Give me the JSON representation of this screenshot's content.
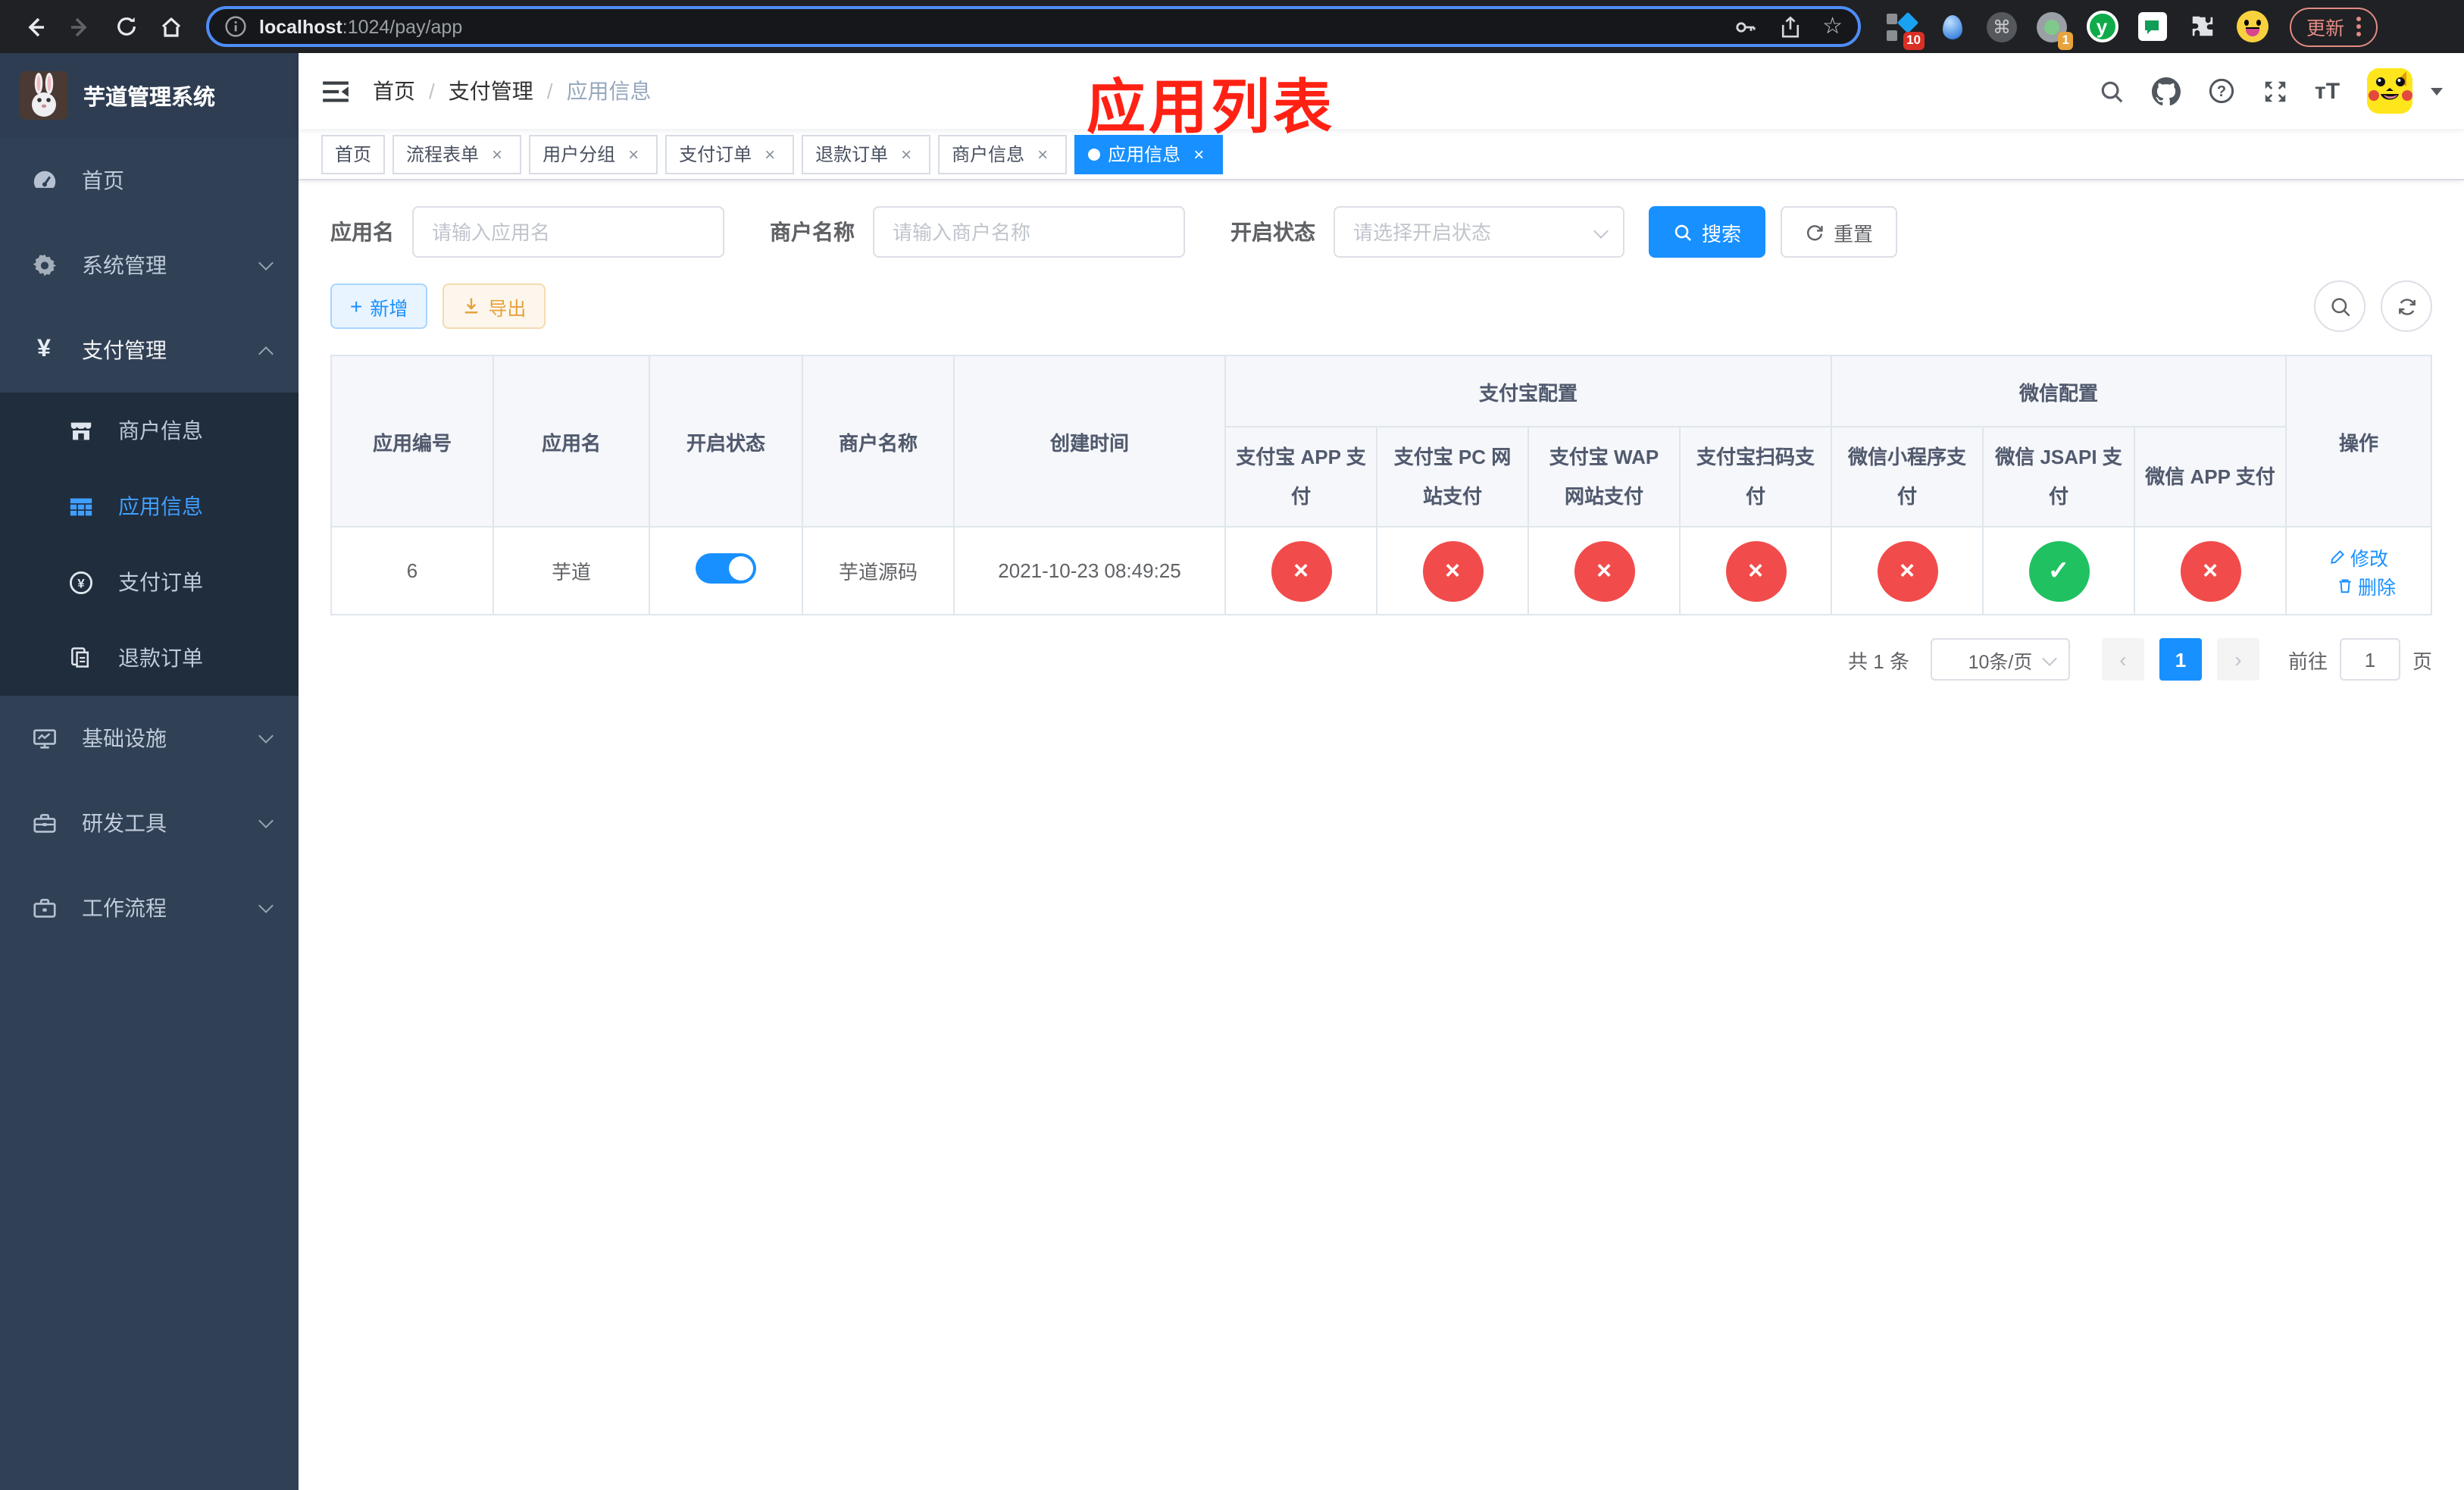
{
  "colors": {
    "primary": "#1890ff",
    "sidebar_active": "#409EFF",
    "danger": "#f24b4b",
    "success": "#20c161",
    "warning": "#e6a23c",
    "annotation_red": "#ff2113"
  },
  "browser": {
    "url_host": "localhost",
    "url_rest": ":1024/pay/app",
    "update_label": "更新",
    "ext_badge_collab": "10",
    "ext_badge_recorder": "1"
  },
  "icons": {
    "star": "☆",
    "command": "⌘",
    "close": "×",
    "check": "✓",
    "prev": "‹",
    "next": "›",
    "plus": "+",
    "download": "⇩",
    "y_letter": "y"
  },
  "annotation": {
    "text": "应用列表"
  },
  "sidebar": {
    "title": "芋道管理系统",
    "home": "首页",
    "system": "系统管理",
    "payment": "支付管理",
    "sub_merchant": "商户信息",
    "sub_app": "应用信息",
    "sub_pay_order": "支付订单",
    "sub_refund_order": "退款订单",
    "infra": "基础设施",
    "dev_tools": "研发工具",
    "workflow": "工作流程"
  },
  "breadcrumb": {
    "items": [
      "首页",
      "支付管理",
      "应用信息"
    ]
  },
  "tabs": {
    "items": [
      "首页",
      "流程表单",
      "用户分组",
      "支付订单",
      "退款订单",
      "商户信息",
      "应用信息"
    ],
    "active": "应用信息"
  },
  "filters": {
    "app_name_label": "应用名",
    "app_name_placeholder": "请输入应用名",
    "merchant_label": "商户名称",
    "merchant_placeholder": "请输入商户名称",
    "status_label": "开启状态",
    "status_placeholder": "请选择开启状态",
    "search_button": "搜索",
    "reset_button": "重置"
  },
  "toolbar": {
    "add_button": "新增",
    "export_button": "导出"
  },
  "table": {
    "headers": {
      "app_id": "应用编号",
      "app_name": "应用名",
      "status": "开启状态",
      "merchant": "商户名称",
      "created": "创建时间",
      "alipay_group": "支付宝配置",
      "wechat_group": "微信配置",
      "alipay_app": "支付宝 APP 支付",
      "alipay_pc": "支付宝 PC 网站支付",
      "alipay_wap": "支付宝 WAP 网站支付",
      "alipay_qr": "支付宝扫码支付",
      "wx_mini": "微信小程序支付",
      "wx_jsapi": "微信 JSAPI 支付",
      "wx_app": "微信 APP 支付",
      "ops": "操作"
    },
    "status_glyphs": {
      "enabled": "✓",
      "disabled": "×"
    },
    "row": {
      "id": "6",
      "name": "芋道",
      "enabled": true,
      "merchant": "芋道源码",
      "created": "2021-10-23 08:49:25",
      "configs": [
        "disabled",
        "disabled",
        "disabled",
        "disabled",
        "disabled",
        "enabled",
        "disabled"
      ],
      "edit_label": "修改",
      "delete_label": "删除"
    }
  },
  "pagination": {
    "total_text": "共 1 条",
    "page_size": "10条/页",
    "current_page": "1",
    "goto_label": "前往",
    "goto_value": "1",
    "goto_unit": "页"
  }
}
